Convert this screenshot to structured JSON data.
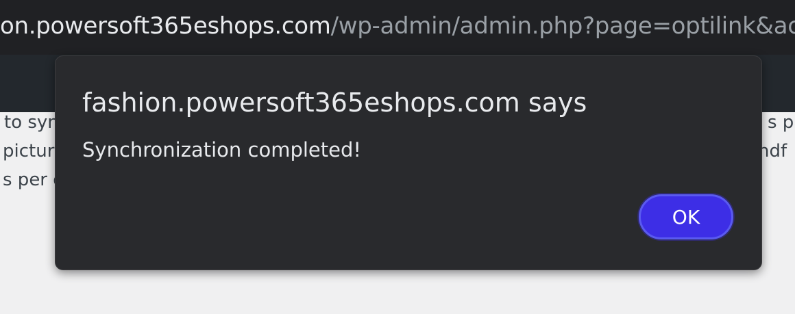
{
  "browser": {
    "url_host": "on.powersoft365eshops.com",
    "url_path": "/wp-admin/admin.php?page=optilink&action=sizes&"
  },
  "page": {
    "text_left": [
      "to syn",
      "picture",
      "s per day."
    ],
    "text_right": [
      "s pa",
      "ndf"
    ]
  },
  "dialog": {
    "title": "fashion.powersoft365eshops.com says",
    "message": "Synchronization completed!",
    "ok_label": "OK"
  },
  "colors": {
    "dialog_bg": "#292a2d",
    "button_accent": "#3d2ee6",
    "page_bg": "#f0f0f1",
    "url_bar_bg": "#202124"
  }
}
